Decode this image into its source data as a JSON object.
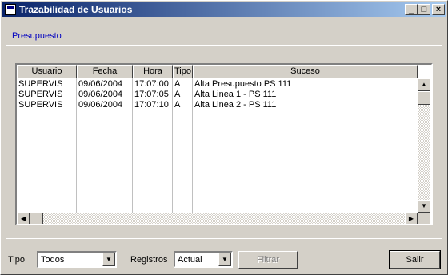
{
  "window": {
    "title": "Trazabilidad de Usuarios"
  },
  "header": {
    "text": "Presupuesto"
  },
  "grid": {
    "columns": [
      "Usuario",
      "Fecha",
      "Hora",
      "Tipo",
      "Suceso"
    ],
    "rows": [
      [
        "SUPERVIS",
        "09/06/2004",
        "17:07:00",
        "A",
        "Alta Presupuesto PS 111"
      ],
      [
        "SUPERVIS",
        "09/06/2004",
        "17:07:05",
        "A",
        "Alta Linea 1 - PS 111"
      ],
      [
        "SUPERVIS",
        "09/06/2004",
        "17:07:10",
        "A",
        "Alta Linea 2 - PS 111"
      ]
    ]
  },
  "footer": {
    "tipo_label": "Tipo",
    "tipo_value": "Todos",
    "registros_label": "Registros",
    "registros_value": "Actual",
    "filtrar_label": "Filtrar",
    "salir_label": "Salir"
  }
}
